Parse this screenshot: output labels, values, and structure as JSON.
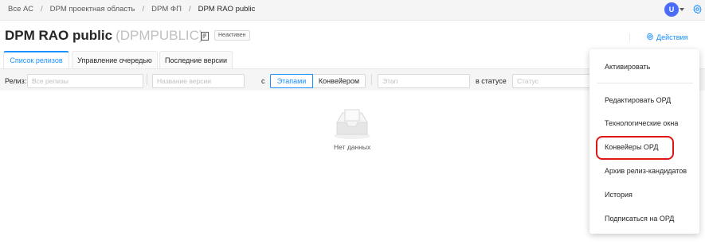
{
  "breadcrumb": [
    "Все АС",
    "DPM проектная область",
    "DPM ФП",
    "DPM RAO public"
  ],
  "user": {
    "avatar_letter": "U"
  },
  "page": {
    "title": "DPM RAO public",
    "code": "(DPMPUBLIC)",
    "status_badge": "Неактивен",
    "actions_label": "Действия"
  },
  "tabs": [
    {
      "label": "Список релизов",
      "active": true
    },
    {
      "label": "Управление очередью",
      "active": false
    },
    {
      "label": "Последние версии",
      "active": false
    }
  ],
  "filters": {
    "release_label": "Релиз:",
    "release_placeholder": "Все релизы",
    "version_placeholder": "Название версии",
    "with_label": "с",
    "toggle_stages": "Этапами",
    "toggle_pipeline": "Конвейером",
    "stage_placeholder": "Этап",
    "status_label": "в статусе",
    "status_placeholder": "Статус"
  },
  "empty": {
    "text": "Нет данных"
  },
  "actions_menu": {
    "items": [
      "Активировать",
      "Редактировать ОРД",
      "Технологические окна",
      "Конвейеры ОРД",
      "Архив релиз-кандидатов",
      "История",
      "Подписаться на ОРД"
    ],
    "highlighted_item": "Конвейеры ОРД"
  },
  "colors": {
    "accent": "#1890ff",
    "highlight_ring": "#e01515",
    "avatar": "#4a6cf7"
  }
}
